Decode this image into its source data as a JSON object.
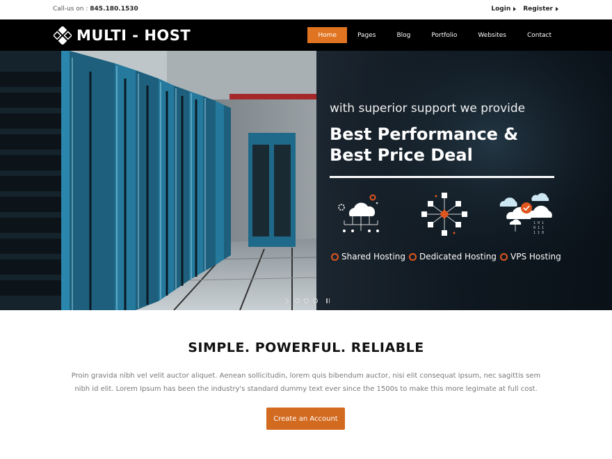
{
  "topbar": {
    "call_label": "Call-us on :",
    "phone": "845.180.1530",
    "login_label": "Login",
    "register_label": "Register"
  },
  "brand": {
    "name": "MULTI - HOST",
    "logo_icon": "diamond-grid-icon"
  },
  "nav": {
    "items": [
      {
        "label": "Home",
        "active": true
      },
      {
        "label": "Pages"
      },
      {
        "label": "Blog"
      },
      {
        "label": "Portfolio"
      },
      {
        "label": "Websites"
      },
      {
        "label": "Contact"
      }
    ]
  },
  "hero": {
    "subtitle": "with superior support we provide",
    "title": "Best Performance & Best Price Deal",
    "features": [
      {
        "label": "Shared Hosting",
        "icon": "cloud-network-icon"
      },
      {
        "label": "Dedicated Hosting",
        "icon": "server-nodes-icon"
      },
      {
        "label": "VPS Hosting",
        "icon": "cloud-data-icon"
      }
    ],
    "slider": {
      "slides": 3,
      "current": 1
    }
  },
  "content": {
    "headline": "SIMPLE. POWERFUL. RELIABLE",
    "paragraph": "Proin gravida nibh vel velit auctor aliquet. Aenean sollicitudin, lorem quis bibendum auctor, nisi elit consequat ipsum, nec sagittis sem nibh id elit. Lorem Ipsum has been the industry's standard dummy text ever since the 1500s to make this more legimate at full cost.",
    "cta_label": "Create an Account"
  },
  "colors": {
    "accent": "#e07420",
    "cta": "#d26a20",
    "nav_bg": "#000000",
    "ring": "#e0561f"
  }
}
